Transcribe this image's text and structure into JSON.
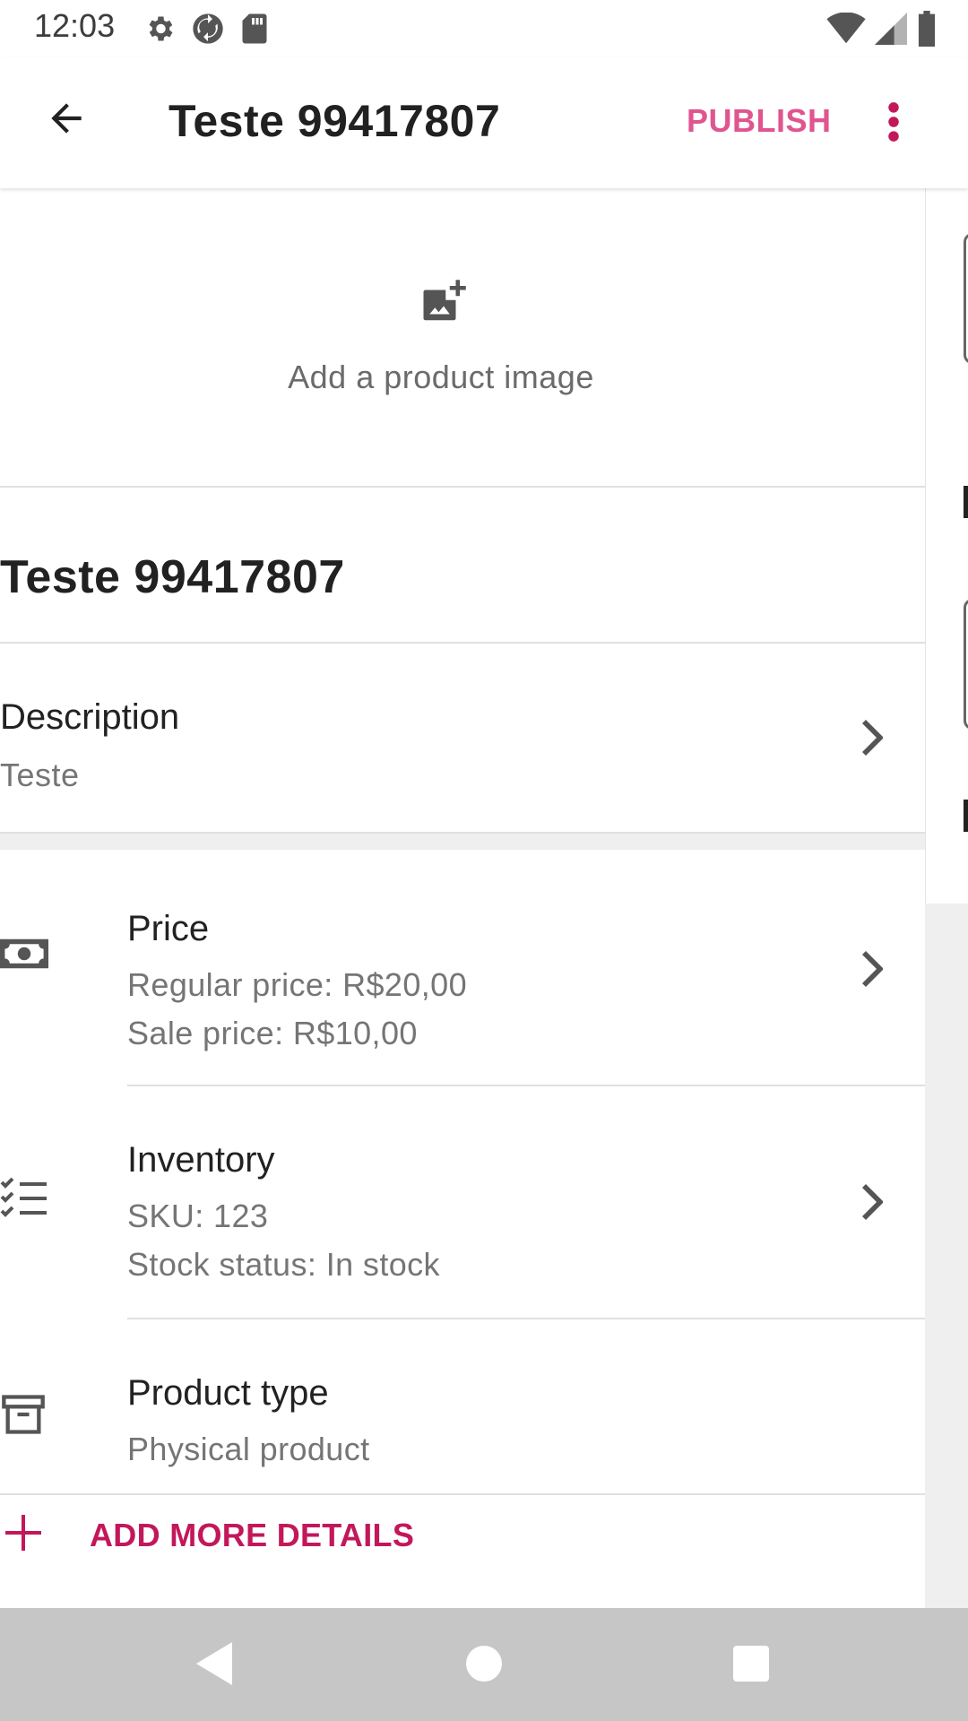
{
  "status_bar": {
    "time": "12:03",
    "left_icons": [
      "settings-icon",
      "sync-icon",
      "sd-card-icon"
    ],
    "right_icons": [
      "wifi-icon",
      "cell-signal-icon",
      "battery-icon"
    ]
  },
  "app_bar": {
    "title": "Teste 99417807",
    "publish_label": "PUBLISH",
    "back_icon": "arrow-back-icon",
    "menu_icon": "more-vert-icon"
  },
  "image_section": {
    "icon": "add-photo-icon",
    "label": "Add a product image"
  },
  "product": {
    "name": "Teste 99417807"
  },
  "description": {
    "label": "Description",
    "value": "Teste"
  },
  "details": {
    "price": {
      "title": "Price",
      "regular": "Regular price: R$20,00",
      "sale": "Sale price: R$10,00",
      "icon": "money-icon"
    },
    "inventory": {
      "title": "Inventory",
      "sku": "SKU: 123",
      "stock": "Stock status: In stock",
      "icon": "checklist-icon"
    },
    "product_type": {
      "title": "Product type",
      "value": "Physical product",
      "icon": "archive-box-icon"
    }
  },
  "add_more": {
    "label": "ADD MORE DETAILS",
    "icon": "plus-icon"
  },
  "nav_bar": {
    "icons": [
      "nav-back-icon",
      "nav-home-icon",
      "nav-recents-icon"
    ]
  },
  "colors": {
    "accent": "#e0558f",
    "accent_dark": "#c2185b",
    "text_primary": "#212121",
    "text_secondary": "#757575",
    "divider": "#e0e0e0",
    "nav_bar": "#c6c6c6"
  }
}
